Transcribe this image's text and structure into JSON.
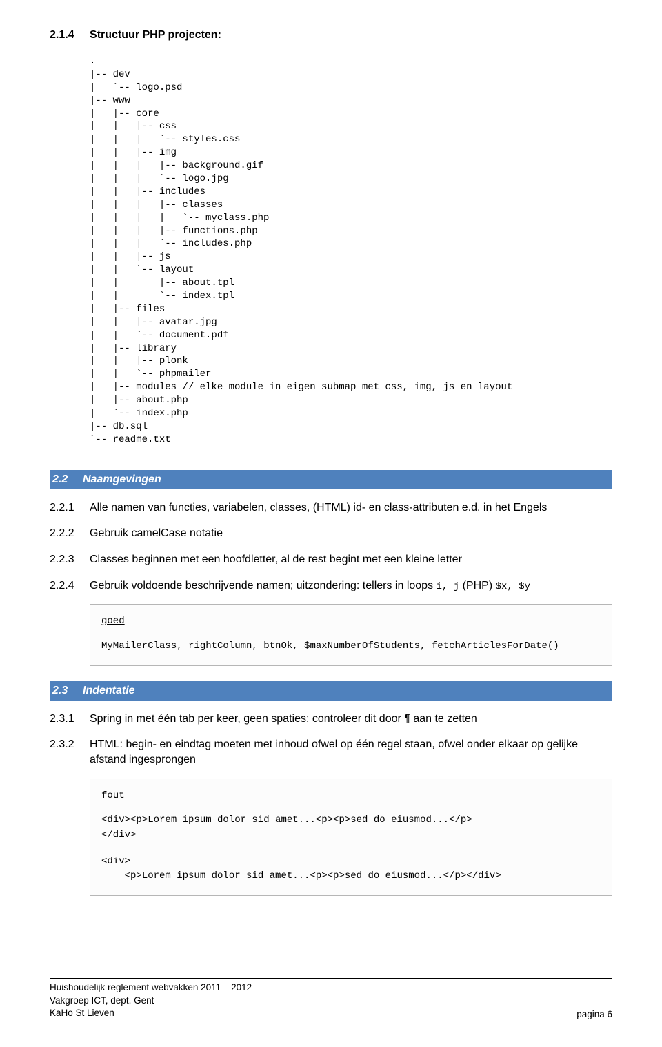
{
  "section214": {
    "num": "2.1.4",
    "title": "Structuur PHP projecten:",
    "tree": ".\n|-- dev\n|   `-- logo.psd\n|-- www\n|   |-- core\n|   |   |-- css\n|   |   |   `-- styles.css\n|   |   |-- img\n|   |   |   |-- background.gif\n|   |   |   `-- logo.jpg\n|   |   |-- includes\n|   |   |   |-- classes\n|   |   |   |   `-- myclass.php\n|   |   |   |-- functions.php\n|   |   |   `-- includes.php\n|   |   |-- js\n|   |   `-- layout\n|   |       |-- about.tpl\n|   |       `-- index.tpl\n|   |-- files\n|   |   |-- avatar.jpg\n|   |   `-- document.pdf\n|   |-- library\n|   |   |-- plonk\n|   |   `-- phpmailer\n|   |-- modules // elke module in eigen submap met css, img, js en layout\n|   |-- about.php\n|   `-- index.php\n|-- db.sql\n`-- readme.txt"
  },
  "section22": {
    "num": "2.2",
    "title": "Naamgevingen",
    "items": [
      {
        "num": "2.2.1",
        "text_pre": "Alle namen van functies, variabelen, classes, (HTML) id- en class-attributen e.d. in het Engels"
      },
      {
        "num": "2.2.2",
        "text_pre": "Gebruik camelCase notatie"
      },
      {
        "num": "2.2.3",
        "text_pre": "Classes beginnen met een hoofdletter, al de rest begint met een kleine letter"
      },
      {
        "num": "2.2.4",
        "text_pre": "Gebruik voldoende beschrijvende namen; uitzondering: tellers in loops ",
        "code1": "i, j",
        "mid": " (PHP) ",
        "code2": "$x, $y"
      }
    ],
    "codebox": {
      "label": "goed",
      "body": "MyMailerClass, rightColumn, btnOk, $maxNumberOfStudents, fetchArticlesForDate()"
    }
  },
  "section23": {
    "num": "2.3",
    "title": "Indentatie",
    "items": [
      {
        "num": "2.3.1",
        "text": "Spring in met één tab per keer, geen spaties; controleer dit door ¶ aan te zetten"
      },
      {
        "num": "2.3.2",
        "text": "HTML: begin- en eindtag moeten met inhoud ofwel op één regel staan, ofwel onder elkaar op gelijke afstand ingesprongen"
      }
    ],
    "codebox": {
      "label": "fout",
      "block1": "<div><p>Lorem ipsum dolor sid amet...<p><p>sed do eiusmod...</p>\n</div>",
      "block2": "<div>\n    <p>Lorem ipsum dolor sid amet...<p><p>sed do eiusmod...</p></div>"
    }
  },
  "footer": {
    "line1": "Huishoudelijk reglement webvakken 2011 – 2012",
    "line2": "Vakgroep ICT, dept. Gent",
    "line3": "KaHo St Lieven",
    "right": "pagina 6"
  }
}
